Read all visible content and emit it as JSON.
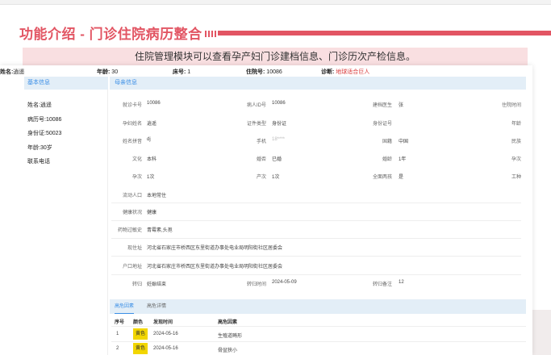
{
  "header": {
    "title": "功能介绍 - 门诊住院病历整合",
    "banner": "住院管理模块可以查看孕产妇门诊建档信息、门诊历次产检信息。"
  },
  "patient_row": {
    "name_label": "姓名:",
    "name": "逍遥",
    "age_label": "年龄:",
    "age": "30",
    "bed_label": "床号:",
    "bed": "1",
    "admission_label": "住院号:",
    "admission": "10086",
    "diagnosis_label": "诊断:",
    "diagnosis": "地球适合巨人"
  },
  "left_panel": {
    "heading": "基本信息",
    "items": [
      "姓名:逍遥",
      "病历号:10086",
      "身份证:50023",
      "年龄:30岁",
      "联系电话"
    ]
  },
  "mother_info": {
    "heading": "母亲信息",
    "fields": [
      {
        "label": "就诊卡号",
        "value": "10086"
      },
      {
        "label": "病人ID号",
        "value": "10086"
      },
      {
        "label": "建档医生",
        "value": "张"
      },
      {
        "label": "住院时间",
        "value": ""
      },
      {
        "label": "孕妇姓名",
        "value": "逍遥"
      },
      {
        "label": "证件类型",
        "value": "身份证"
      },
      {
        "label": "身份证号",
        "value": ""
      },
      {
        "label": "年龄",
        "value": ""
      },
      {
        "label": "姓名拼音",
        "value": "dj"
      },
      {
        "label": "手机",
        "value": "18****"
      },
      {
        "label": "国籍",
        "value": "中国"
      },
      {
        "label": "民族",
        "value": ""
      },
      {
        "label": "文化",
        "value": "本科"
      },
      {
        "label": "婚否",
        "value": "已婚"
      },
      {
        "label": "婚龄",
        "value": "1年"
      },
      {
        "label": "孕次",
        "value": ""
      },
      {
        "label": "孕次",
        "value": "1次"
      },
      {
        "label": "产次",
        "value": "1次"
      },
      {
        "label": "全面两孩",
        "value": "是"
      },
      {
        "label": "工种",
        "value": ""
      },
      {
        "label": "流动人口",
        "value": "本地常住"
      },
      {
        "label": "健康状况",
        "value": "健康"
      },
      {
        "label": "药物过敏史",
        "value": "青霉素,头孢"
      },
      {
        "label": "现住址",
        "value": "河北省石家庄市桥西区东里街道办事处电业局明阳街社区居委会"
      },
      {
        "label": "户口地址",
        "value": "河北省石家庄市桥西区东里街道办事处电业局明阳街社区居委会"
      },
      {
        "label": "转归",
        "value": "妊娠结束"
      },
      {
        "label": "转归时间",
        "value": "2024-05-09"
      },
      {
        "label": "转归备注",
        "value": "12"
      }
    ]
  },
  "tabs": [
    "高危因素",
    "高危详情"
  ],
  "risk_table": {
    "headers": [
      "序号",
      "颜色",
      "发现时间",
      "高危因素"
    ],
    "rows": [
      {
        "no": "1",
        "color": "黄色",
        "date": "2024-05-16",
        "factor": "生殖道畸形"
      },
      {
        "no": "2",
        "color": "黄色",
        "date": "2024-05-16",
        "factor": "骨盆狭小"
      }
    ]
  },
  "colors": {
    "accent": "#e25563",
    "banner_bg": "#f9dfe1",
    "badge_yellow": "#f2d600",
    "link_blue": "#3a8ee6"
  }
}
